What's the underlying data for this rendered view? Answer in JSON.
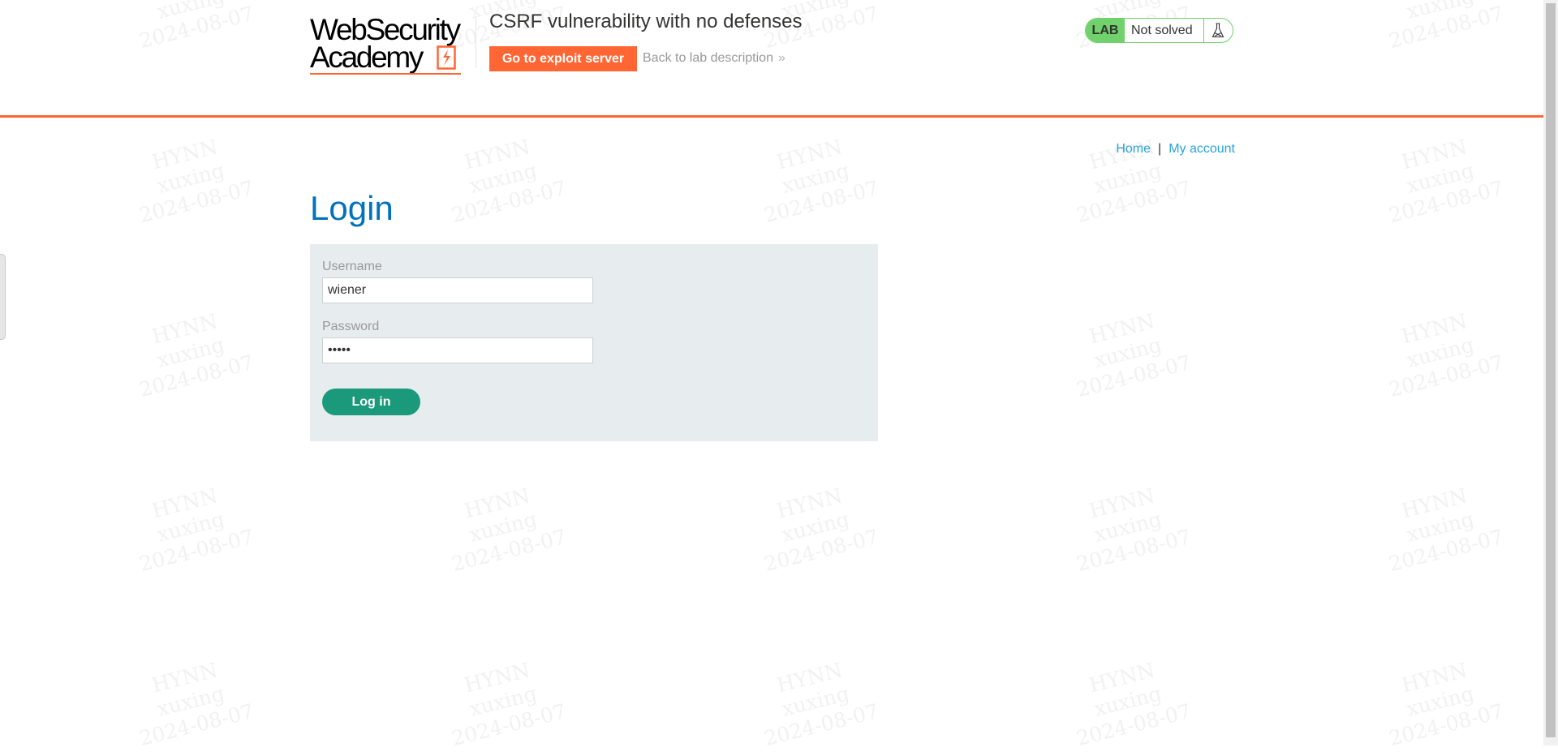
{
  "watermark": {
    "line1": "HYNN",
    "line2": "xuxing",
    "line3": "2024-08-07"
  },
  "header": {
    "logo_line1": "WebSecurity",
    "logo_line2": "Academy",
    "lab_title": "CSRF vulnerability with no defenses",
    "exploit_button_label": "Go to exploit server",
    "back_link_label": "Back to lab description",
    "back_link_chevron": "»",
    "lab_badge": "LAB",
    "lab_status": "Not solved",
    "lab_icon": "flask-icon"
  },
  "nav": {
    "home_label": "Home",
    "separator": "|",
    "account_label": "My account"
  },
  "main": {
    "title": "Login",
    "username_label": "Username",
    "username_value": "wiener",
    "password_label": "Password",
    "password_value": "peter",
    "login_button_label": "Log in"
  },
  "colors": {
    "accent_orange": "#ff6633",
    "title_blue": "#0071bc",
    "link_blue": "#29a3df",
    "lab_green": "#70d16d",
    "button_green": "#1a9a7a",
    "panel_bg": "#e7ecee"
  }
}
